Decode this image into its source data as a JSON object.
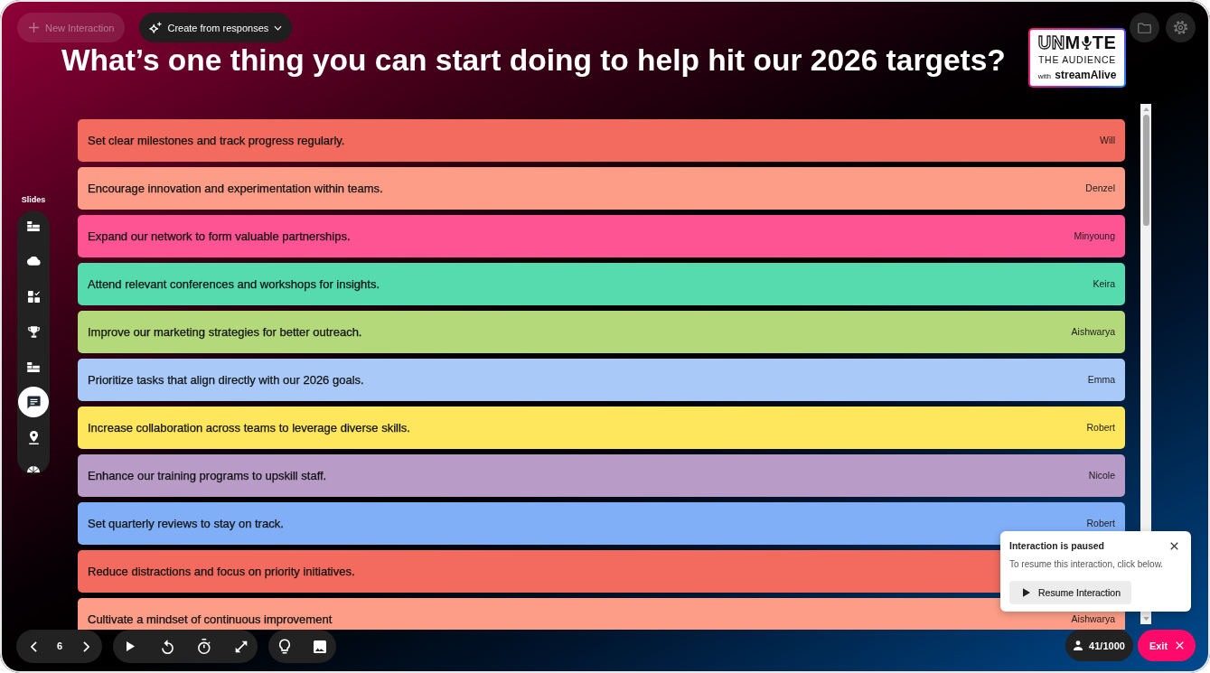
{
  "toolbar": {
    "new_interaction": {
      "label": "New Interaction",
      "disabled": true
    },
    "create_from_responses": {
      "label": "Create from responses"
    }
  },
  "question": "What’s one thing you can start doing to help hit our 2026 targets?",
  "logo": {
    "wordmark_outline": "UN",
    "wordmark_solid": "M",
    "wordmark_end": "TE",
    "subtitle": "THE AUDIENCE",
    "tagline_prefix": "with",
    "tagline_brand": "streamAlive"
  },
  "sidebar": {
    "label": "Slides",
    "items": [
      {
        "kind": "ranking",
        "selected": false
      },
      {
        "kind": "cloud",
        "selected": false
      },
      {
        "kind": "quiz",
        "selected": false
      },
      {
        "kind": "trophy",
        "selected": false
      },
      {
        "kind": "ranking",
        "selected": false
      },
      {
        "kind": "chat",
        "selected": true
      },
      {
        "kind": "map",
        "selected": false
      },
      {
        "kind": "wheel",
        "selected": false
      }
    ]
  },
  "responses": [
    {
      "text": "Set clear milestones and track progress regularly.",
      "author": "Will",
      "color": "#f26b5e"
    },
    {
      "text": "Encourage innovation and experimentation within teams.",
      "author": "Denzel",
      "color": "#fd9d87"
    },
    {
      "text": "Expand our network to form valuable partnerships.",
      "author": "Minyoung",
      "color": "#ff5493"
    },
    {
      "text": "Attend relevant conferences and workshops for insights.",
      "author": "Keira",
      "color": "#55dbae"
    },
    {
      "text": "Improve our marketing strategies for better outreach.",
      "author": "Aishwarya",
      "color": "#b3d97b"
    },
    {
      "text": "Prioritize tasks that align directly with our 2026 goals.",
      "author": "Emma",
      "color": "#a9caf9"
    },
    {
      "text": "Increase collaboration across teams to leverage diverse skills.",
      "author": "Robert",
      "color": "#fee75c"
    },
    {
      "text": "Enhance our training programs to upskill staff.",
      "author": "Nicole",
      "color": "#b89bc6"
    },
    {
      "text": "Set quarterly reviews to stay on track.",
      "author": "Robert",
      "color": "#80aff7"
    },
    {
      "text": "Reduce distractions and focus on priority initiatives.",
      "color": "#f26b5e"
    },
    {
      "text": "Cultivate a mindset of continuous improvement",
      "author": "Aishwarya",
      "color": "#fd9d87"
    }
  ],
  "pause_notice": {
    "title": "Interaction is paused",
    "message": "To resume this interaction, click below.",
    "button": "Resume Interaction"
  },
  "slide_navigation": {
    "current": "6"
  },
  "participants": "41/1000",
  "exit_button": "Exit"
}
